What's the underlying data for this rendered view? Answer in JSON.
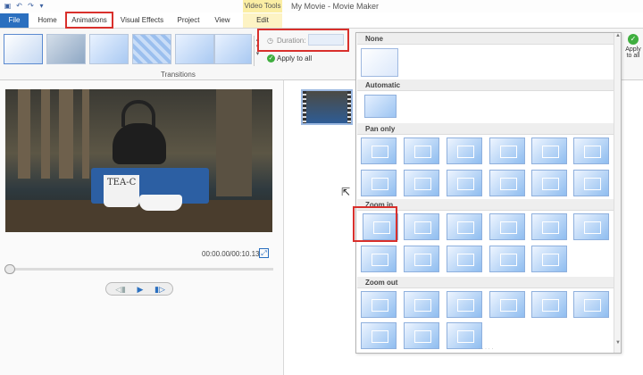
{
  "app_title": "My Movie - Movie Maker",
  "context_tab_label": "Video Tools",
  "tabs": {
    "file": "File",
    "home": "Home",
    "animations": "Animations",
    "visual_effects": "Visual Effects",
    "project": "Project",
    "view": "View",
    "edit": "Edit"
  },
  "ribbon": {
    "group_label": "Transitions",
    "duration_label": "Duration:",
    "apply_to_all": "Apply to all",
    "apply_right_line1": "Apply",
    "apply_right_line2": "to all"
  },
  "preview": {
    "time_readout": "00:00.00/00:10.13",
    "mug_text": "TEA-C"
  },
  "gallery": {
    "sections": {
      "none": "None",
      "automatic": "Automatic",
      "pan_only": "Pan only",
      "zoom_in": "Zoom in",
      "zoom_out": "Zoom out"
    }
  },
  "icons": {
    "save": "save-icon",
    "undo": "undo-icon",
    "redo": "redo-icon",
    "play": "play-icon",
    "prev_frame": "previous-frame-icon",
    "next_frame": "next-frame-icon",
    "fullscreen": "fullscreen-icon",
    "cursor": "mouse-cursor-icon"
  },
  "colors": {
    "file_tab": "#2a6fbf",
    "context_tab": "#fbeea4",
    "highlight_box": "#d9302c",
    "tile_blue": "#8fbdf0"
  }
}
